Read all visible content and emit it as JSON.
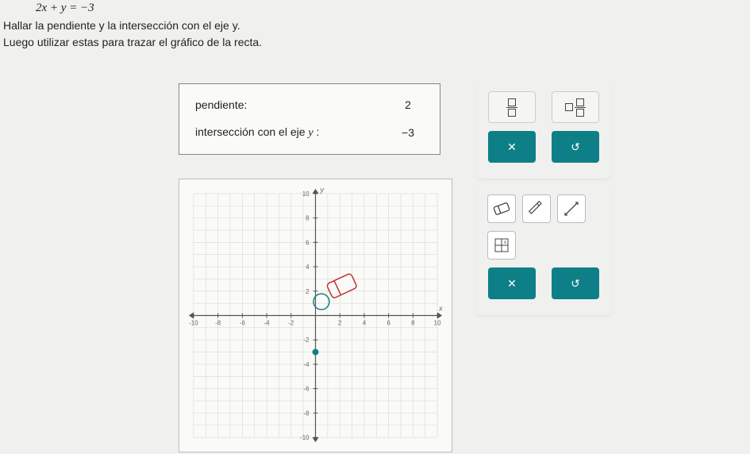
{
  "equation": "2x + y = −3",
  "instructions": {
    "line1": "Hallar la pendiente y la intersección con el eje y.",
    "line2": "Luego utilizar estas para trazar el gráfico de la recta."
  },
  "answers": {
    "slope_label": "pendiente:",
    "slope_value": "2",
    "yint_label_pre": "intersección con el eje ",
    "yint_var": "y",
    "yint_label_post": " :",
    "yint_value": "−3"
  },
  "buttons": {
    "close": "✕",
    "undo": "↺"
  },
  "chart_data": {
    "type": "scatter",
    "title": "",
    "xlabel": "x",
    "ylabel": "y",
    "xlim": [
      -10,
      10
    ],
    "ylim": [
      -10,
      10
    ],
    "xticks": [
      -10,
      -8,
      -6,
      -4,
      -2,
      2,
      4,
      6,
      8,
      10
    ],
    "yticks": [
      -10,
      -8,
      -6,
      -4,
      -2,
      2,
      4,
      6,
      8,
      10
    ],
    "grid": true,
    "points": [
      {
        "x": 0,
        "y": -3,
        "color": "#0f7f87"
      }
    ],
    "markers": [
      {
        "type": "eraser",
        "x": 1.5,
        "y": 1.5
      }
    ]
  }
}
